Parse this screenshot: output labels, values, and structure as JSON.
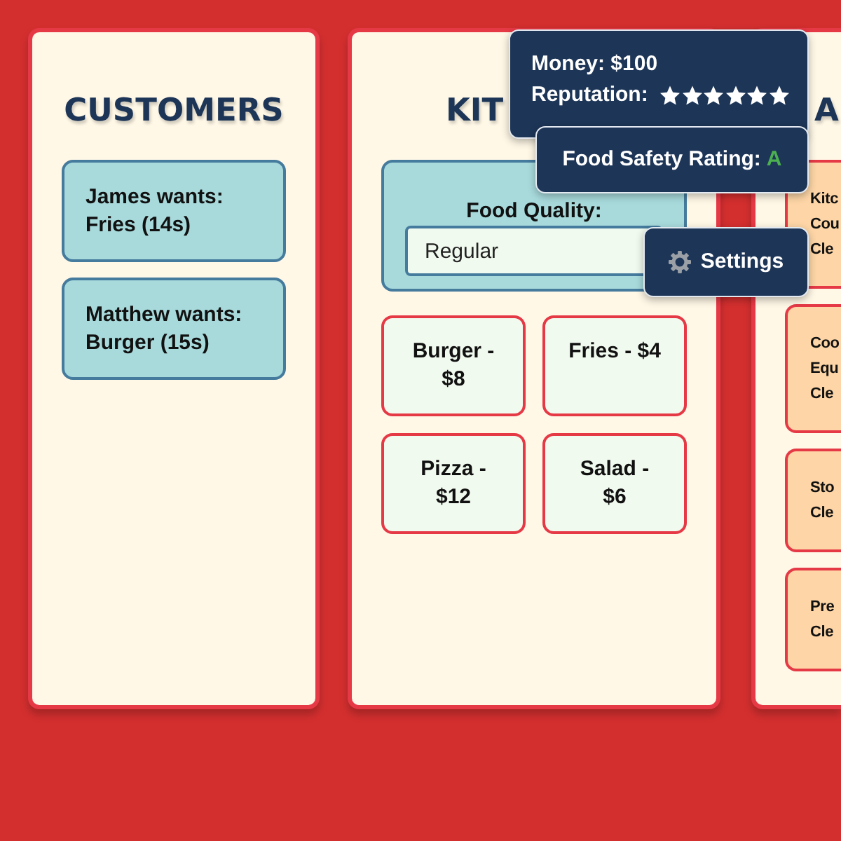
{
  "customers_panel": {
    "heading": "CUSTOMERS",
    "orders": [
      {
        "text": "James wants: Fries (14s)"
      },
      {
        "text": "Matthew wants: Burger (15s)"
      }
    ]
  },
  "kitchen_panel": {
    "heading": "KIT",
    "food_quality": {
      "label": "Food Quality:",
      "value": "Regular"
    },
    "menu": [
      {
        "label": "Burger - $8"
      },
      {
        "label": "Fries - $4"
      },
      {
        "label": "Pizza - $12"
      },
      {
        "label": "Salad - $6"
      }
    ]
  },
  "panel_3": {
    "heading": "A",
    "items": [
      {
        "text": "Kitc Cou Cle"
      },
      {
        "text": "Coo Equ Cle"
      },
      {
        "text": "Sto Cle"
      },
      {
        "text": "Pre Cle"
      }
    ]
  },
  "status_popup": {
    "money": "Money: $100",
    "reputation": {
      "label": "Reputation:",
      "stars": 6
    }
  },
  "safety_popup": {
    "label": "Food Safety Rating:",
    "grade": "A"
  },
  "settings_button": {
    "label": "Settings"
  }
}
